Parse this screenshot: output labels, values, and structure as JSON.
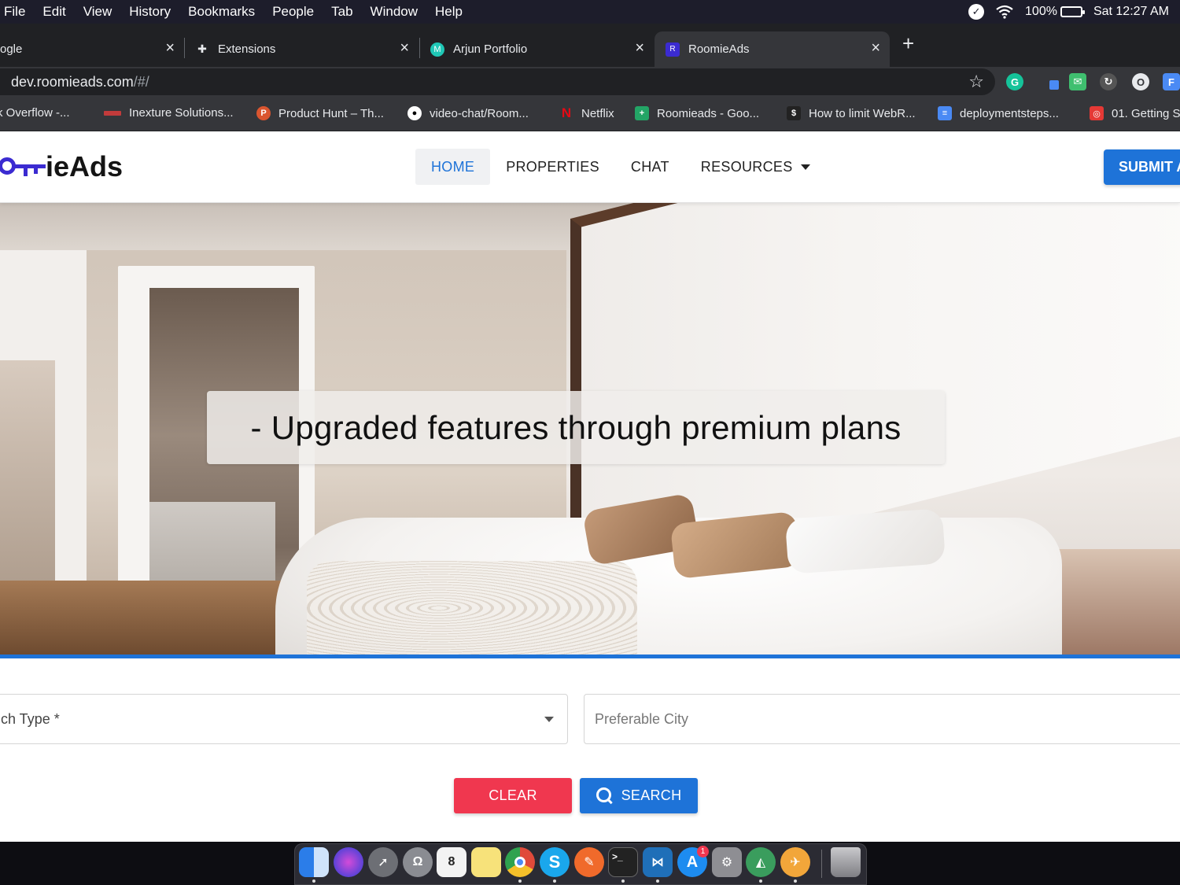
{
  "menubar": {
    "items": [
      "File",
      "Edit",
      "View",
      "History",
      "Bookmarks",
      "People",
      "Tab",
      "Window",
      "Help"
    ],
    "battery": "100%",
    "clock": "Sat 12:27 AM"
  },
  "tabs": [
    {
      "title": "ogle",
      "icon": "google-icon",
      "active": false
    },
    {
      "title": "Extensions",
      "icon": "puzzle-icon",
      "active": false
    },
    {
      "title": "Arjun Portfolio",
      "icon": "portfolio-icon",
      "active": false
    },
    {
      "title": "RoomieAds",
      "icon": "roomieads-icon",
      "active": true
    }
  ],
  "address": {
    "host": "dev.roomieads.com",
    "path": "/#/"
  },
  "bookmarks": [
    {
      "label": "k Overflow -...",
      "icon": "stackoverflow-icon"
    },
    {
      "label": "Inexture Solutions...",
      "icon": "inexture-icon"
    },
    {
      "label": "Product Hunt – Th...",
      "icon": "producthunt-icon",
      "glyph": "P"
    },
    {
      "label": "video-chat/Room...",
      "icon": "github-icon"
    },
    {
      "label": "Netflix",
      "icon": "netflix-icon",
      "glyph": "N"
    },
    {
      "label": "Roomieads - Goo...",
      "icon": "google-sheets-icon"
    },
    {
      "label": "How to limit WebR...",
      "icon": "webrtc-icon"
    },
    {
      "label": "deploymentsteps...",
      "icon": "google-docs-icon"
    },
    {
      "label": "01. Getting S",
      "icon": "bookmark-red-icon"
    }
  ],
  "site": {
    "logo_text": "ieAds",
    "nav": [
      {
        "label": "HOME",
        "active": true
      },
      {
        "label": "PROPERTIES",
        "active": false
      },
      {
        "label": "CHAT",
        "active": false
      },
      {
        "label": "RESOURCES",
        "active": false,
        "dropdown": true
      }
    ],
    "submit_label": "SUBMIT A",
    "hero_caption": "- Upgraded features through premium plans",
    "search_type_label": "ch Type *",
    "city_placeholder": "Preferable City",
    "clear_label": "CLEAR",
    "search_label": "SEARCH",
    "colors": {
      "primary": "#1e73d8",
      "danger": "#f0374f",
      "logo": "#3b2bd1"
    }
  },
  "dock": [
    {
      "name": "finder-icon",
      "color": "#2b7de9"
    },
    {
      "name": "siri-icon",
      "color": "#5a3fd6"
    },
    {
      "name": "launchpad-icon",
      "color": "#6d6f75"
    },
    {
      "name": "tableplus-icon",
      "color": "#8a8c92"
    },
    {
      "name": "calendar-icon",
      "color": "#f3f3f3",
      "glyph": "8"
    },
    {
      "name": "notes-icon",
      "color": "#f7e27a"
    },
    {
      "name": "chrome-icon",
      "color": "#e04a3a"
    },
    {
      "name": "skype-icon",
      "color": "#1aa7ec",
      "glyph": "S"
    },
    {
      "name": "postman-icon",
      "color": "#f06a2b"
    },
    {
      "name": "terminal-icon",
      "color": "#222",
      "glyph": ">_"
    },
    {
      "name": "vscode-icon",
      "color": "#1f6fb8"
    },
    {
      "name": "appstore-icon",
      "color": "#1d8cf0",
      "glyph": "A",
      "badge": "1"
    },
    {
      "name": "system-preferences-icon",
      "color": "#8e8e93"
    },
    {
      "name": "android-studio-icon",
      "color": "#3a9d5d"
    },
    {
      "name": "transmit-icon",
      "color": "#f2a63a"
    },
    {
      "name": "trash-icon",
      "color": "#9a9a9f"
    }
  ]
}
